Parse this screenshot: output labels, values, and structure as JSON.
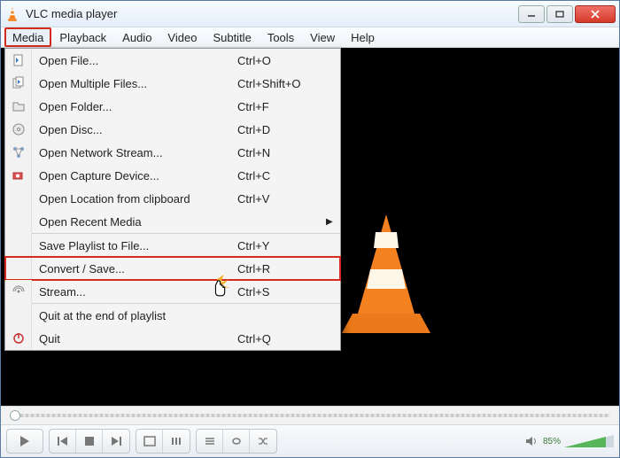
{
  "window": {
    "title": "VLC media player"
  },
  "menubar": {
    "items": [
      "Media",
      "Playback",
      "Audio",
      "Video",
      "Subtitle",
      "Tools",
      "View",
      "Help"
    ]
  },
  "dropdown": {
    "items": [
      {
        "label": "Open File...",
        "shortcut": "Ctrl+O",
        "icon": "file"
      },
      {
        "label": "Open Multiple Files...",
        "shortcut": "Ctrl+Shift+O",
        "icon": "files"
      },
      {
        "label": "Open Folder...",
        "shortcut": "Ctrl+F",
        "icon": "folder"
      },
      {
        "label": "Open Disc...",
        "shortcut": "Ctrl+D",
        "icon": "disc"
      },
      {
        "label": "Open Network Stream...",
        "shortcut": "Ctrl+N",
        "icon": "network"
      },
      {
        "label": "Open Capture Device...",
        "shortcut": "Ctrl+C",
        "icon": "capture"
      },
      {
        "label": "Open Location from clipboard",
        "shortcut": "Ctrl+V",
        "icon": ""
      },
      {
        "label": "Open Recent Media",
        "shortcut": "",
        "icon": "",
        "submenu": true
      }
    ],
    "items2": [
      {
        "label": "Save Playlist to File...",
        "shortcut": "Ctrl+Y",
        "icon": ""
      },
      {
        "label": "Convert / Save...",
        "shortcut": "Ctrl+R",
        "icon": "",
        "highlight": true
      },
      {
        "label": "Stream...",
        "shortcut": "Ctrl+S",
        "icon": "stream"
      }
    ],
    "items3": [
      {
        "label": "Quit at the end of playlist",
        "shortcut": "",
        "icon": ""
      },
      {
        "label": "Quit",
        "shortcut": "Ctrl+Q",
        "icon": "quit"
      }
    ]
  },
  "controls": {
    "volume_pct": "85%"
  }
}
